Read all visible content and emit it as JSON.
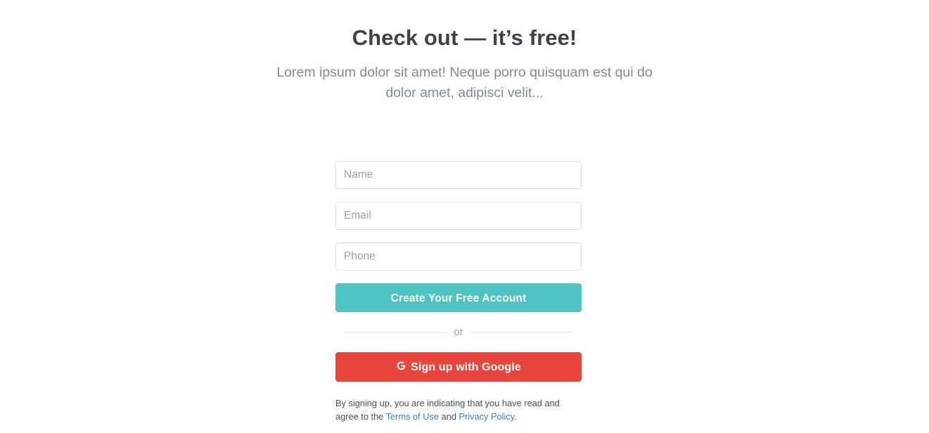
{
  "hero": {
    "title": "Check out — it’s free!",
    "subtitle": "Lorem ipsum dolor sit amet! Neque porro quisquam est qui do dolor amet, adipisci velit..."
  },
  "form": {
    "name_placeholder": "Name",
    "name_value": "",
    "email_placeholder": "Email",
    "email_value": "",
    "phone_placeholder": "Phone",
    "phone_value": "",
    "submit_label": "Create Your Free Account",
    "divider_label": "or",
    "google_label": "Sign up with Google",
    "google_icon": "google-g-icon"
  },
  "legal": {
    "text_before": "By signing up, you are indicating that you have read and agree to the ",
    "terms_link": "Terms of Use",
    "text_between": " and ",
    "privacy_link": "Privacy Policy",
    "text_after": "."
  },
  "colors": {
    "primary_button": "#4dc4c1",
    "google_button": "#e8463a",
    "heading": "#3c444b",
    "subtitle": "#7c8b9b",
    "link": "#3c7fc7",
    "field_border": "#dcdfe2",
    "placeholder": "#9aa1a8",
    "background": "#ffffff"
  }
}
